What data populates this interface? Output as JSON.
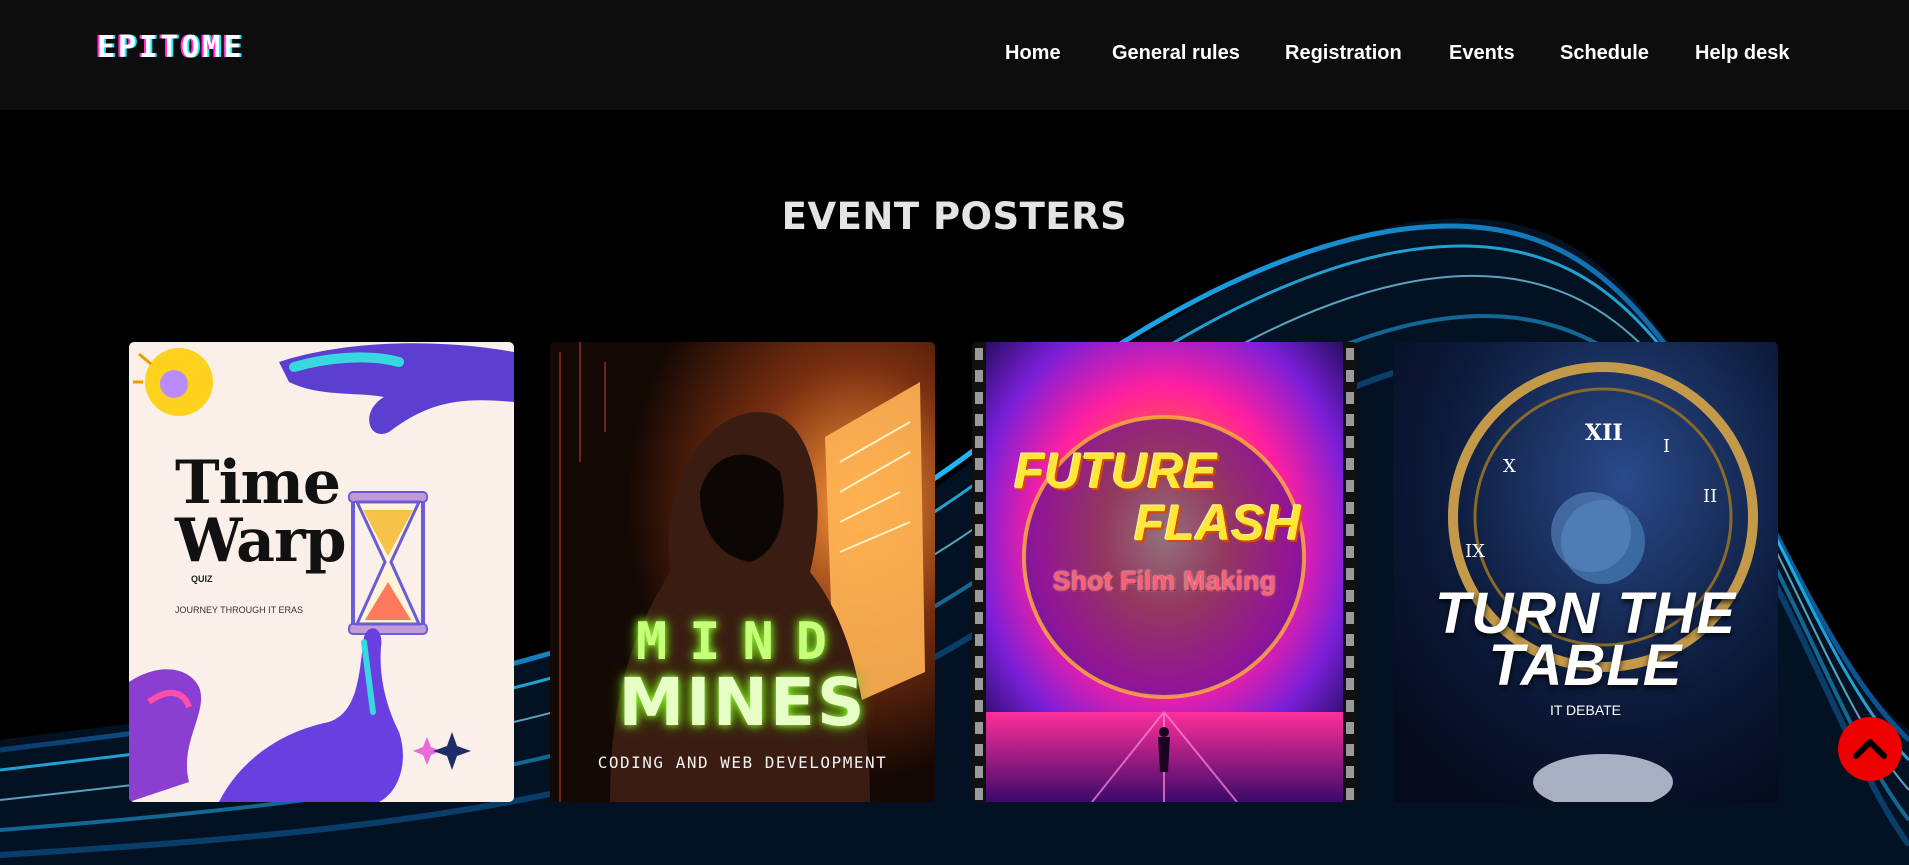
{
  "header": {
    "logo": "EPITOME",
    "nav": [
      "Home",
      "General rules",
      "Registration",
      "Events",
      "Schedule",
      "Help desk"
    ]
  },
  "main": {
    "section_title": "EVENT POSTERS",
    "posters": [
      {
        "title_line1": "Time",
        "title_line2": "Warp",
        "tag": "QUIZ",
        "subtitle": "JOURNEY THROUGH IT ERAS",
        "icons": [
          "lightbulb-icon",
          "hourglass-icon",
          "hand-icon",
          "sparkle-icon"
        ]
      },
      {
        "title_line1": "MIND",
        "title_line2": "MINES",
        "subtitle": "CODING AND WEB DEVELOPMENT",
        "icons": [
          "hooded-hacker-icon",
          "monitor-icon"
        ]
      },
      {
        "title_line1": "FUTURE",
        "title_line2": "FLASH",
        "subtitle": "Shot Film Making",
        "icons": [
          "film-strip-icon",
          "sun-icon"
        ]
      },
      {
        "title_line1": "TURN THE",
        "title_line2": "TABLE",
        "subtitle": "IT DEBATE",
        "icons": [
          "clock-icon",
          "planet-icon"
        ]
      }
    ]
  },
  "colors": {
    "header_bg": "#0d0d0d",
    "page_bg": "#000000",
    "wave": "#1aa3e8",
    "scroll_top": "#ee0000"
  },
  "scroll_top_icon": "chevron-up-icon"
}
